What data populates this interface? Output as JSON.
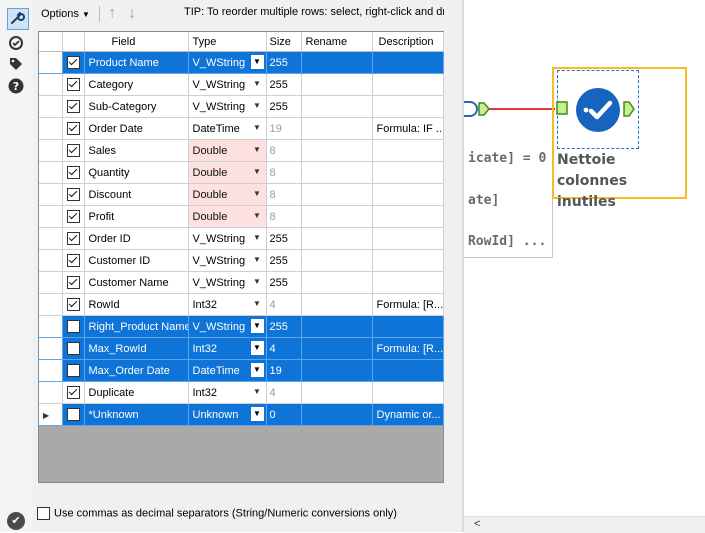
{
  "toolbar": {
    "options_label": "Options",
    "tip": "TIP: To reorder multiple rows: select, right-click and dr"
  },
  "columns": [
    "Field",
    "Type",
    "Size",
    "Rename",
    "Description"
  ],
  "rows": [
    {
      "checked": true,
      "field": "Product Name",
      "type": "V_WString",
      "size": "255",
      "rename": "",
      "description": "",
      "selected": true,
      "double": false,
      "dim": false
    },
    {
      "checked": true,
      "field": "Category",
      "type": "V_WString",
      "size": "255",
      "rename": "",
      "description": "",
      "selected": false,
      "double": false,
      "dim": false
    },
    {
      "checked": true,
      "field": "Sub-Category",
      "type": "V_WString",
      "size": "255",
      "rename": "",
      "description": "",
      "selected": false,
      "double": false,
      "dim": false
    },
    {
      "checked": true,
      "field": "Order Date",
      "type": "DateTime",
      "size": "19",
      "rename": "",
      "description": "Formula: IF ...",
      "selected": false,
      "double": false,
      "dim": true
    },
    {
      "checked": true,
      "field": "Sales",
      "type": "Double",
      "size": "8",
      "rename": "",
      "description": "",
      "selected": false,
      "double": true,
      "dim": true
    },
    {
      "checked": true,
      "field": "Quantity",
      "type": "Double",
      "size": "8",
      "rename": "",
      "description": "",
      "selected": false,
      "double": true,
      "dim": true
    },
    {
      "checked": true,
      "field": "Discount",
      "type": "Double",
      "size": "8",
      "rename": "",
      "description": "",
      "selected": false,
      "double": true,
      "dim": true
    },
    {
      "checked": true,
      "field": "Profit",
      "type": "Double",
      "size": "8",
      "rename": "",
      "description": "",
      "selected": false,
      "double": true,
      "dim": true
    },
    {
      "checked": true,
      "field": "Order ID",
      "type": "V_WString",
      "size": "255",
      "rename": "",
      "description": "",
      "selected": false,
      "double": false,
      "dim": false
    },
    {
      "checked": true,
      "field": "Customer ID",
      "type": "V_WString",
      "size": "255",
      "rename": "",
      "description": "",
      "selected": false,
      "double": false,
      "dim": false
    },
    {
      "checked": true,
      "field": "Customer Name",
      "type": "V_WString",
      "size": "255",
      "rename": "",
      "description": "",
      "selected": false,
      "double": false,
      "dim": false
    },
    {
      "checked": true,
      "field": "RowId",
      "type": "Int32",
      "size": "4",
      "rename": "",
      "description": "Formula: [R...",
      "selected": false,
      "double": false,
      "dim": true
    },
    {
      "checked": false,
      "field": "Right_Product Name",
      "type": "V_WString",
      "size": "255",
      "rename": "",
      "description": "",
      "selected": true,
      "double": false,
      "dim": false
    },
    {
      "checked": false,
      "field": "Max_RowId",
      "type": "Int32",
      "size": "4",
      "rename": "",
      "description": "Formula: [R...",
      "selected": true,
      "double": false,
      "dim": false
    },
    {
      "checked": false,
      "field": "Max_Order Date",
      "type": "DateTime",
      "size": "19",
      "rename": "",
      "description": "",
      "selected": true,
      "double": false,
      "dim": false
    },
    {
      "checked": true,
      "field": "Duplicate",
      "type": "Int32",
      "size": "4",
      "rename": "",
      "description": "",
      "selected": false,
      "double": false,
      "dim": true
    },
    {
      "checked": false,
      "field": "*Unknown",
      "type": "Unknown",
      "size": "0",
      "rename": "",
      "description": "Dynamic or...",
      "selected": true,
      "double": false,
      "dim": false,
      "current": true
    }
  ],
  "bottom": {
    "commas_label": "Use commas as decimal separators (String/Numeric conversions only)",
    "commas_checked": false
  },
  "canvas": {
    "prev_lines": [
      "icate] = 0",
      "ate]",
      "RowId] ..."
    ],
    "node_label": "Nettoie colonnes inutiles"
  },
  "colors": {
    "selection": "#0f74d7",
    "node_highlight": "#f4bd25",
    "node_icon": "#1764c0",
    "connection": "#e23a3a"
  },
  "icons": [
    "configuration-icon",
    "annotation-icon",
    "tag-icon",
    "help-icon",
    "ok-icon"
  ]
}
